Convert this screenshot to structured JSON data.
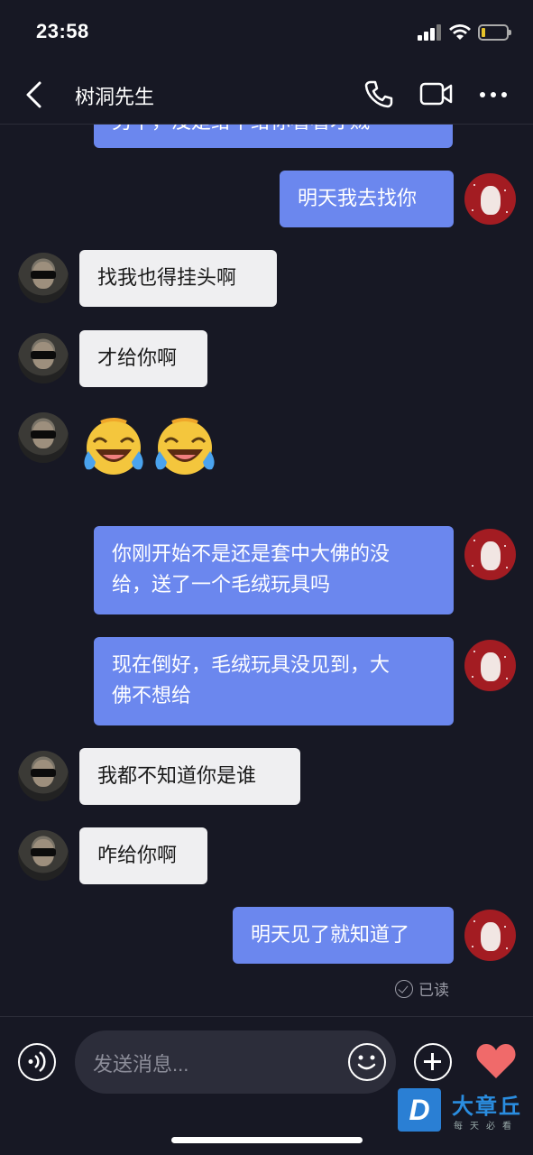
{
  "status_bar": {
    "time": "23:58"
  },
  "header": {
    "title": "树洞先生",
    "back_icon": "chevron-left-icon",
    "call_icon": "phone-icon",
    "video_icon": "video-camera-icon",
    "more_icon": "more-dots-icon"
  },
  "messages": [
    {
      "side": "right",
      "text": "另半，没是给半给你看看才贼"
    },
    {
      "side": "right",
      "text": "明天我去找你"
    },
    {
      "side": "left",
      "text": "找我也得挂头啊"
    },
    {
      "side": "left",
      "text": "才给你啊"
    },
    {
      "side": "left",
      "type": "emoji",
      "emoji": "laughing-crying-emoji"
    },
    {
      "side": "right",
      "lines": [
        "你刚开始不是还是套中大佛的没",
        "给，送了一个毛绒玩具吗"
      ]
    },
    {
      "side": "right",
      "lines": [
        "现在倒好，毛绒玩具没见到，大",
        "佛不想给"
      ]
    },
    {
      "side": "left",
      "text": "我都不知道你是谁"
    },
    {
      "side": "left",
      "text": "咋给你啊"
    },
    {
      "side": "right",
      "text": "明天见了就知道了"
    }
  ],
  "read_status": "已读",
  "input": {
    "placeholder": "发送消息..."
  },
  "watermark": {
    "name": "大章丘",
    "sub": "每天必看",
    "logo": "D"
  },
  "colors": {
    "background": "#171824",
    "outgoing_bubble": "#6b87ee",
    "incoming_bubble": "#efeff1",
    "heart": "#f06a6a"
  }
}
